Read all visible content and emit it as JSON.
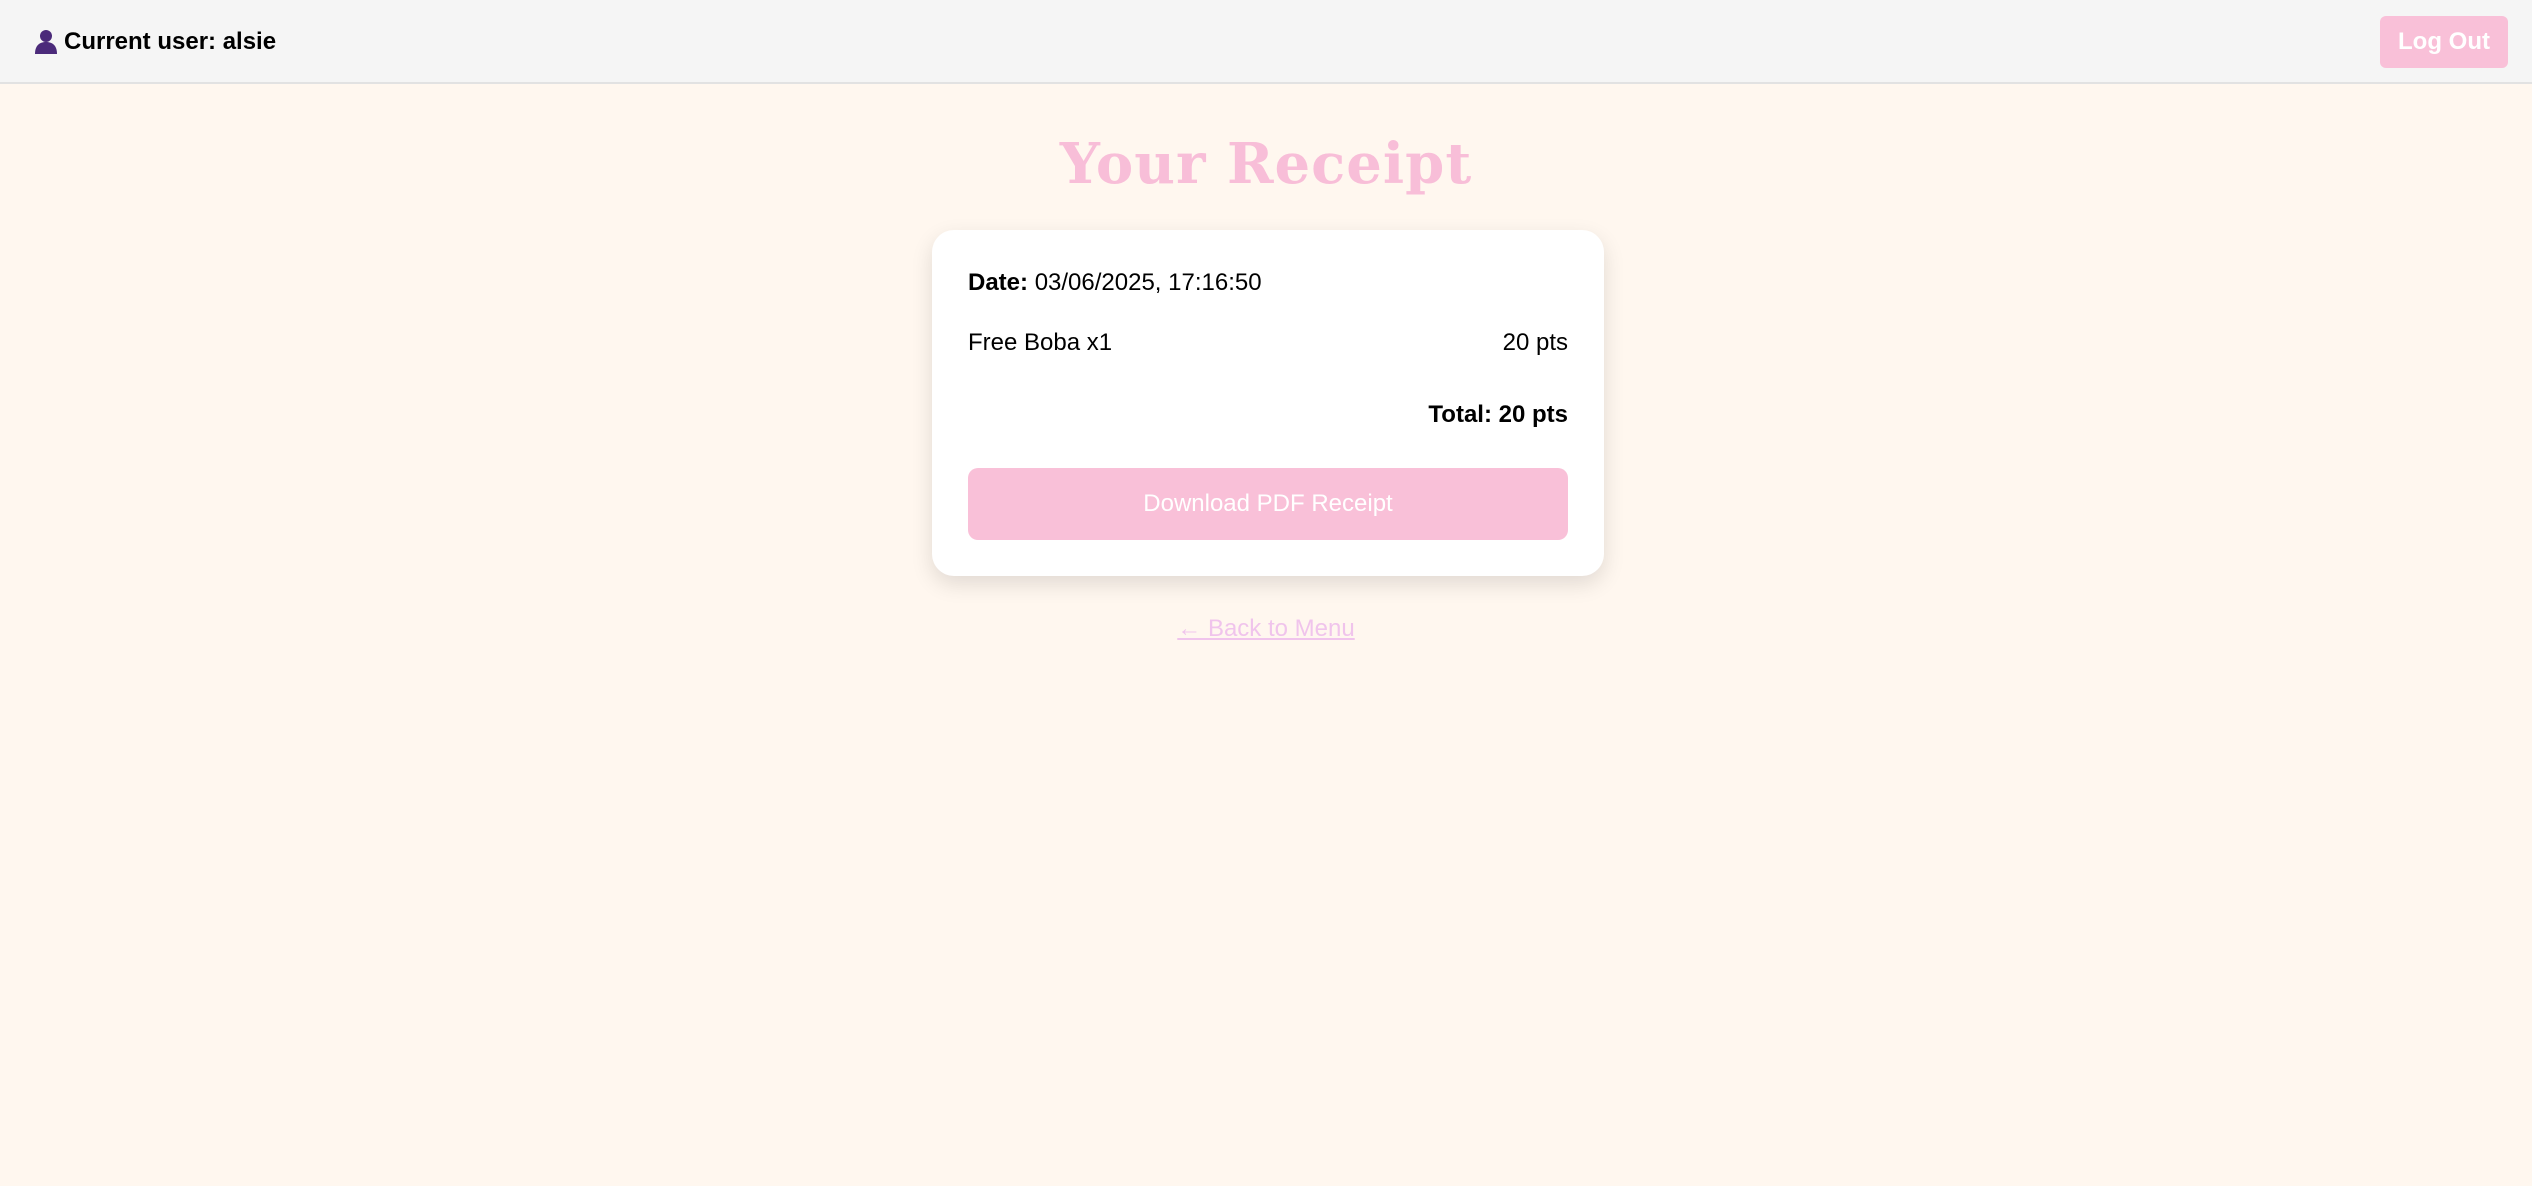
{
  "header": {
    "user_label": "Current user: alsie",
    "user_icon": "user-icon",
    "logout_label": "Log Out"
  },
  "main": {
    "title": "Your Receipt"
  },
  "receipt": {
    "date_label": "Date:",
    "date_value": "03/06/2025, 17:16:50",
    "items": [
      {
        "name": "Free Boba x1",
        "points": "20 pts"
      }
    ],
    "total": "Total: 20 pts",
    "download_label": "Download PDF Receipt"
  },
  "footer": {
    "back_link": "← Back to Menu"
  },
  "colors": {
    "background": "#fff7ef",
    "accent_pink": "#f9c0d8",
    "title_pink": "#f8bed8",
    "link_lilac": "#f0c4ec",
    "icon_purple": "#4b2a7a"
  }
}
